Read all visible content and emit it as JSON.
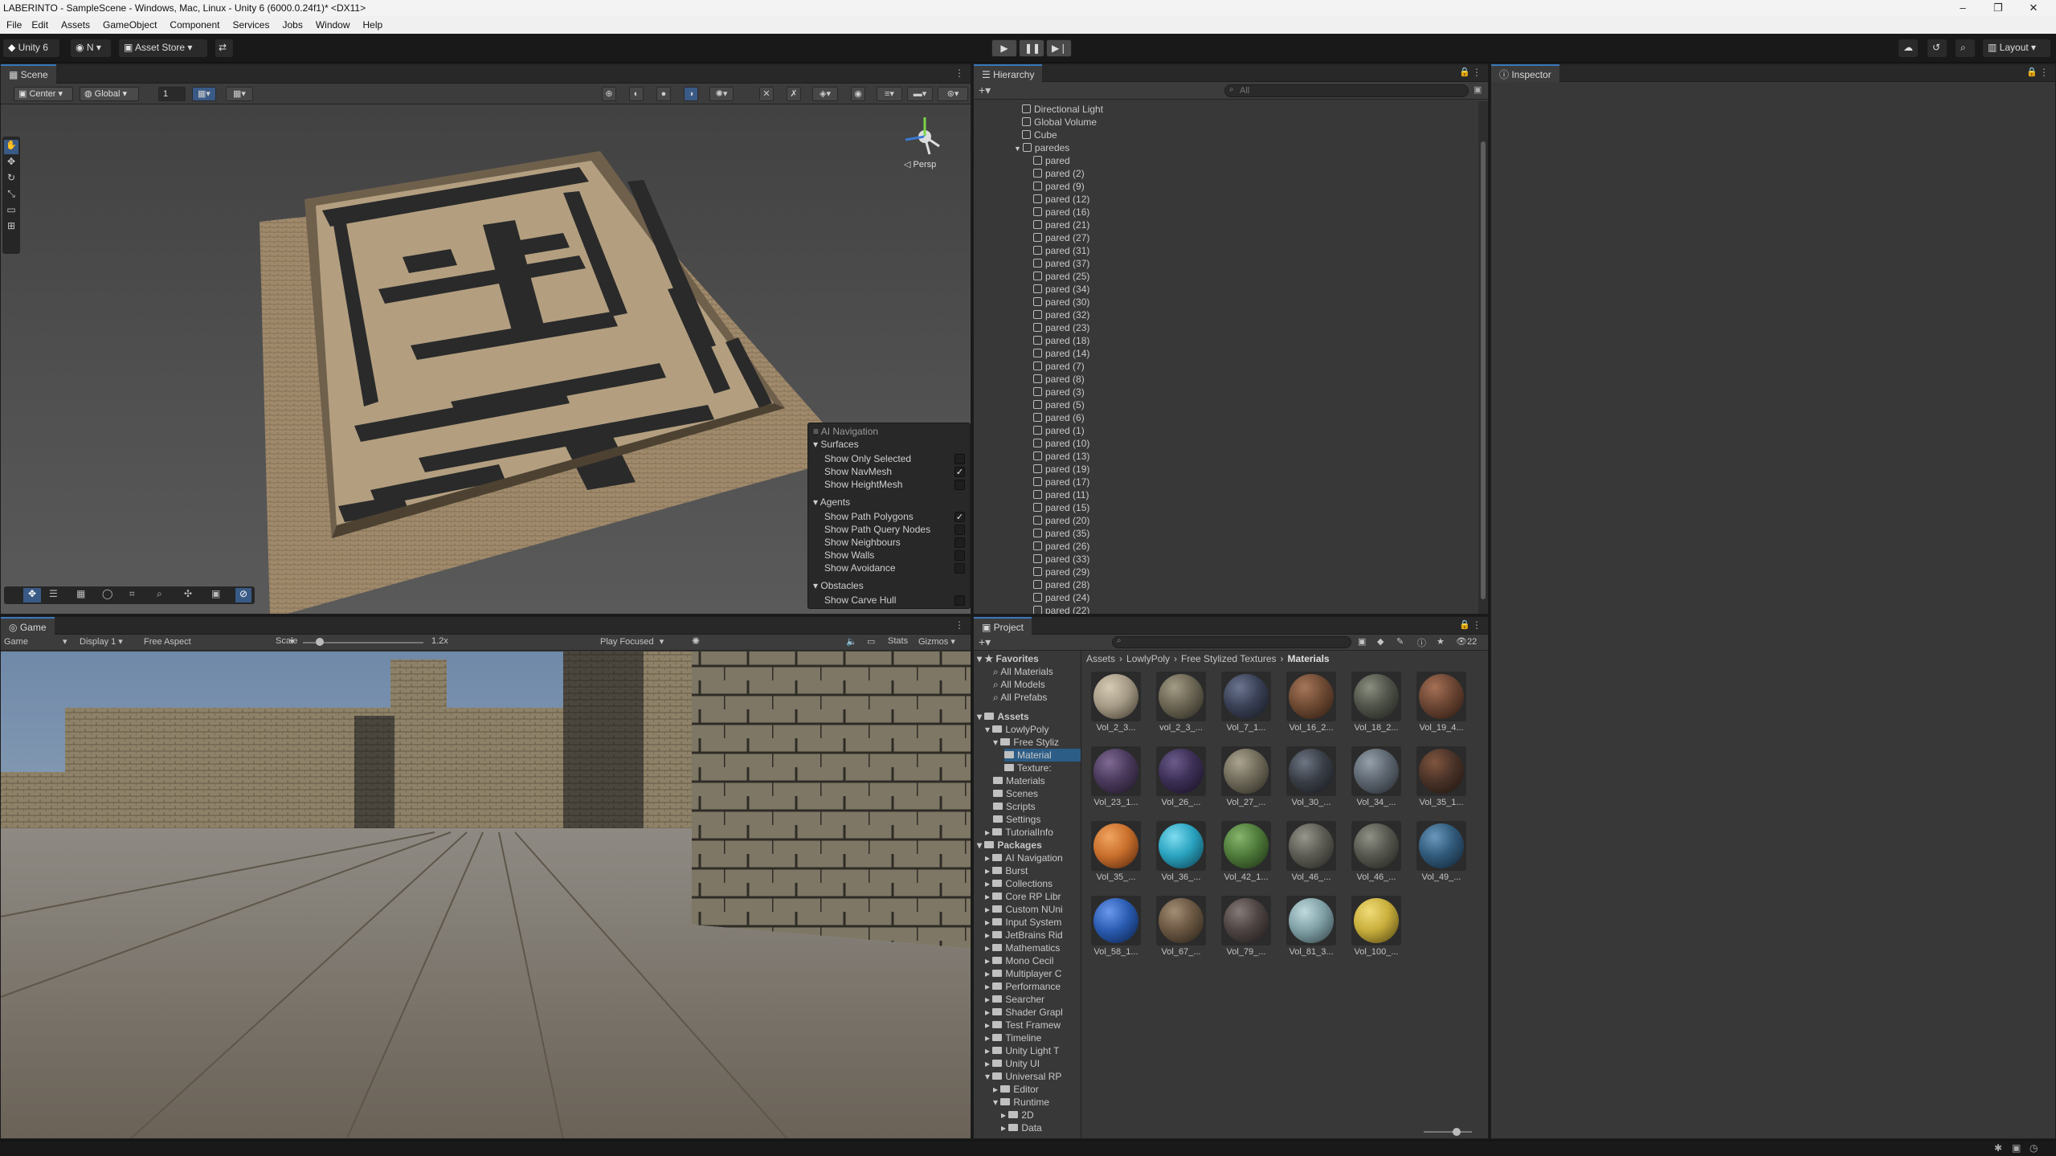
{
  "window": {
    "title": "LABERINTO - SampleScene - Windows, Mac, Linux - Unity 6 (6000.0.24f1)* <DX11>"
  },
  "menu": [
    "File",
    "Edit",
    "Assets",
    "GameObject",
    "Component",
    "Services",
    "Jobs",
    "Window",
    "Help"
  ],
  "toolbar": {
    "unity": "Unity 6",
    "account": "N",
    "asset_store": "Asset Store",
    "layout": "Layout"
  },
  "scene": {
    "tab": "Scene",
    "pivot": "Center",
    "space": "Global",
    "grid_value": "1",
    "persp": "◁ Persp"
  },
  "nav": {
    "title": "AI Navigation",
    "surfaces": "Surfaces",
    "show_only_selected": "Show Only Selected",
    "show_navmesh": "Show NavMesh",
    "show_heightmesh": "Show HeightMesh",
    "agents": "Agents",
    "show_path_polygons": "Show Path Polygons",
    "show_path_query_nodes": "Show Path Query Nodes",
    "show_neighbours": "Show Neighbours",
    "show_walls": "Show Walls",
    "show_avoidance": "Show Avoidance",
    "obstacles": "Obstacles",
    "show_carve_hull": "Show Carve Hull"
  },
  "game": {
    "tab": "Game",
    "mode": "Game",
    "display": "Display 1",
    "aspect": "Free Aspect",
    "scale_label": "Scale",
    "scale_value": "1.2x",
    "play_focused": "Play Focused",
    "stats": "Stats",
    "gizmos": "Gizmos"
  },
  "hierarchy": {
    "tab": "Hierarchy",
    "search_placeholder": "All",
    "items": [
      "Directional Light",
      "Global Volume",
      "Cube",
      "paredes",
      "pared",
      "pared (2)",
      "pared (9)",
      "pared (12)",
      "pared (16)",
      "pared (21)",
      "pared (27)",
      "pared (31)",
      "pared (37)",
      "pared (25)",
      "pared (34)",
      "pared (30)",
      "pared (32)",
      "pared (23)",
      "pared (18)",
      "pared (14)",
      "pared (7)",
      "pared (8)",
      "pared (3)",
      "pared (5)",
      "pared (6)",
      "pared (1)",
      "pared (10)",
      "pared (13)",
      "pared (19)",
      "pared (17)",
      "pared (11)",
      "pared (15)",
      "pared (20)",
      "pared (35)",
      "pared (26)",
      "pared (33)",
      "pared (29)",
      "pared (28)",
      "pared (24)",
      "pared (22)"
    ]
  },
  "inspector": {
    "tab": "Inspector"
  },
  "project": {
    "tab": "Project",
    "count": "22",
    "breadcrumb": [
      "Assets",
      "LowlyPoly",
      "Free Stylized Textures",
      "Materials"
    ],
    "favorites": {
      "label": "Favorites",
      "items": [
        "All Materials",
        "All Models",
        "All Prefabs"
      ]
    },
    "assets": {
      "label": "Assets",
      "items": [
        "LowlyPoly",
        "Free Styliz",
        "Material",
        "Texture:",
        "Materials",
        "Scenes",
        "Scripts",
        "Settings",
        "TutorialInfo"
      ]
    },
    "packages": {
      "label": "Packages",
      "items": [
        "AI Navigation",
        "Burst",
        "Collections",
        "Core RP Libr",
        "Custom NUni",
        "Input System",
        "JetBrains Rid",
        "Mathematics",
        "Mono Cecil",
        "Multiplayer C",
        "Performance",
        "Searcher",
        "Shader Grapl",
        "Test Framew",
        "Timeline",
        "Unity Light T",
        "Unity UI",
        "Universal RP",
        "Editor",
        "Runtime",
        "2D",
        "Data"
      ]
    },
    "materials": [
      {
        "name": "Vol_2_3...",
        "color": "#a59a86"
      },
      {
        "name": "vol_2_3_...",
        "color": "#6b6553"
      },
      {
        "name": "Vol_7_1...",
        "color": "#3a4156"
      },
      {
        "name": "Vol_16_2...",
        "color": "#6e4a33"
      },
      {
        "name": "Vol_18_2...",
        "color": "#4f5349"
      },
      {
        "name": "Vol_19_4...",
        "color": "#6a4533"
      },
      {
        "name": "Vol_23_1...",
        "color": "#4b3a5c"
      },
      {
        "name": "Vol_26_...",
        "color": "#3c2f55"
      },
      {
        "name": "Vol_27_...",
        "color": "#6f6a59"
      },
      {
        "name": "Vol_30_...",
        "color": "#3a3f47"
      },
      {
        "name": "Vol_34_...",
        "color": "#5d6670"
      },
      {
        "name": "Vol_35_1...",
        "color": "#4a3328"
      },
      {
        "name": "Vol_35_...",
        "color": "#c96f2c"
      },
      {
        "name": "Vol_36_...",
        "color": "#2aa3c0"
      },
      {
        "name": "Vol_42_1...",
        "color": "#4e7a3a"
      },
      {
        "name": "Vol_46_...",
        "color": "#5d5c54"
      },
      {
        "name": "Vol_46_...",
        "color": "#56574e"
      },
      {
        "name": "Vol_49_...",
        "color": "#315a7a"
      },
      {
        "name": "Vol_58_1...",
        "color": "#2a5cb2"
      },
      {
        "name": "Vol_67_...",
        "color": "#6a5742"
      },
      {
        "name": "Vol_79_...",
        "color": "#4d4442"
      },
      {
        "name": "Vol_81_3...",
        "color": "#7fa0a6"
      },
      {
        "name": "Vol_100_...",
        "color": "#c8ae3c"
      }
    ]
  }
}
